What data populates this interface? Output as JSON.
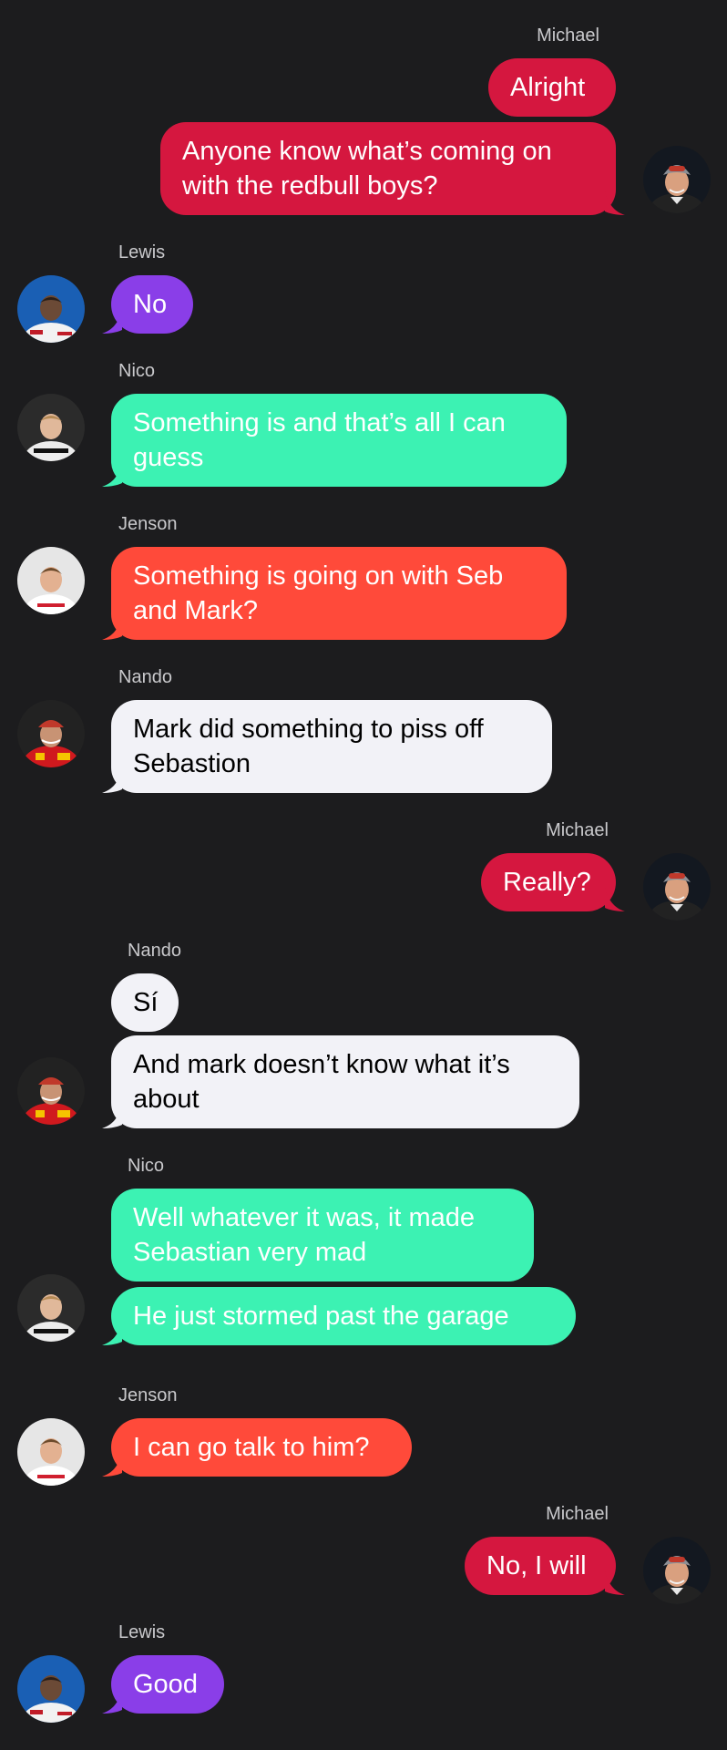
{
  "colors": {
    "background": "#1c1c1e",
    "sender_label": "#c9c9cc",
    "michael": "#d5173f",
    "lewis": "#8a3ee8",
    "nico": "#3cf2b3",
    "jenson": "#ff4a3a",
    "nando": "#f2f2f7"
  },
  "participants": {
    "michael": {
      "name": "Michael",
      "avatar_icon": "michael-avatar-icon"
    },
    "lewis": {
      "name": "Lewis",
      "avatar_icon": "lewis-avatar-icon"
    },
    "nico": {
      "name": "Nico",
      "avatar_icon": "nico-avatar-icon"
    },
    "jenson": {
      "name": "Jenson",
      "avatar_icon": "jenson-avatar-icon"
    },
    "nando": {
      "name": "Nando",
      "avatar_icon": "nando-avatar-icon"
    }
  },
  "messages": [
    {
      "sender": "Michael",
      "text": "Alright"
    },
    {
      "sender": "Michael",
      "text": "Anyone know what’s coming on with the redbull boys?"
    },
    {
      "sender": "Lewis",
      "text": "No"
    },
    {
      "sender": "Nico",
      "text": "Something is and that’s all I can guess"
    },
    {
      "sender": "Jenson",
      "text": "Something is going on with Seb and Mark?"
    },
    {
      "sender": "Nando",
      "text": "Mark did something to piss off Sebastion"
    },
    {
      "sender": "Michael",
      "text": "Really?"
    },
    {
      "sender": "Nando",
      "text": "Sí"
    },
    {
      "sender": "Nando",
      "text": "And mark doesn’t know what it’s about"
    },
    {
      "sender": "Nico",
      "text": "Well whatever it was, it made Sebastian very mad"
    },
    {
      "sender": "Nico",
      "text": "He just stormed past the garage"
    },
    {
      "sender": "Jenson",
      "text": "I can go talk to him?"
    },
    {
      "sender": "Michael",
      "text": "No, I will"
    },
    {
      "sender": "Lewis",
      "text": "Good"
    }
  ],
  "labels": [
    {
      "text": "Michael"
    },
    {
      "text": "Lewis"
    },
    {
      "text": "Nico"
    },
    {
      "text": "Jenson"
    },
    {
      "text": "Nando"
    },
    {
      "text": "Michael"
    },
    {
      "text": "Nando"
    },
    {
      "text": "Nico"
    },
    {
      "text": "Jenson"
    },
    {
      "text": "Michael"
    },
    {
      "text": "Lewis"
    }
  ]
}
